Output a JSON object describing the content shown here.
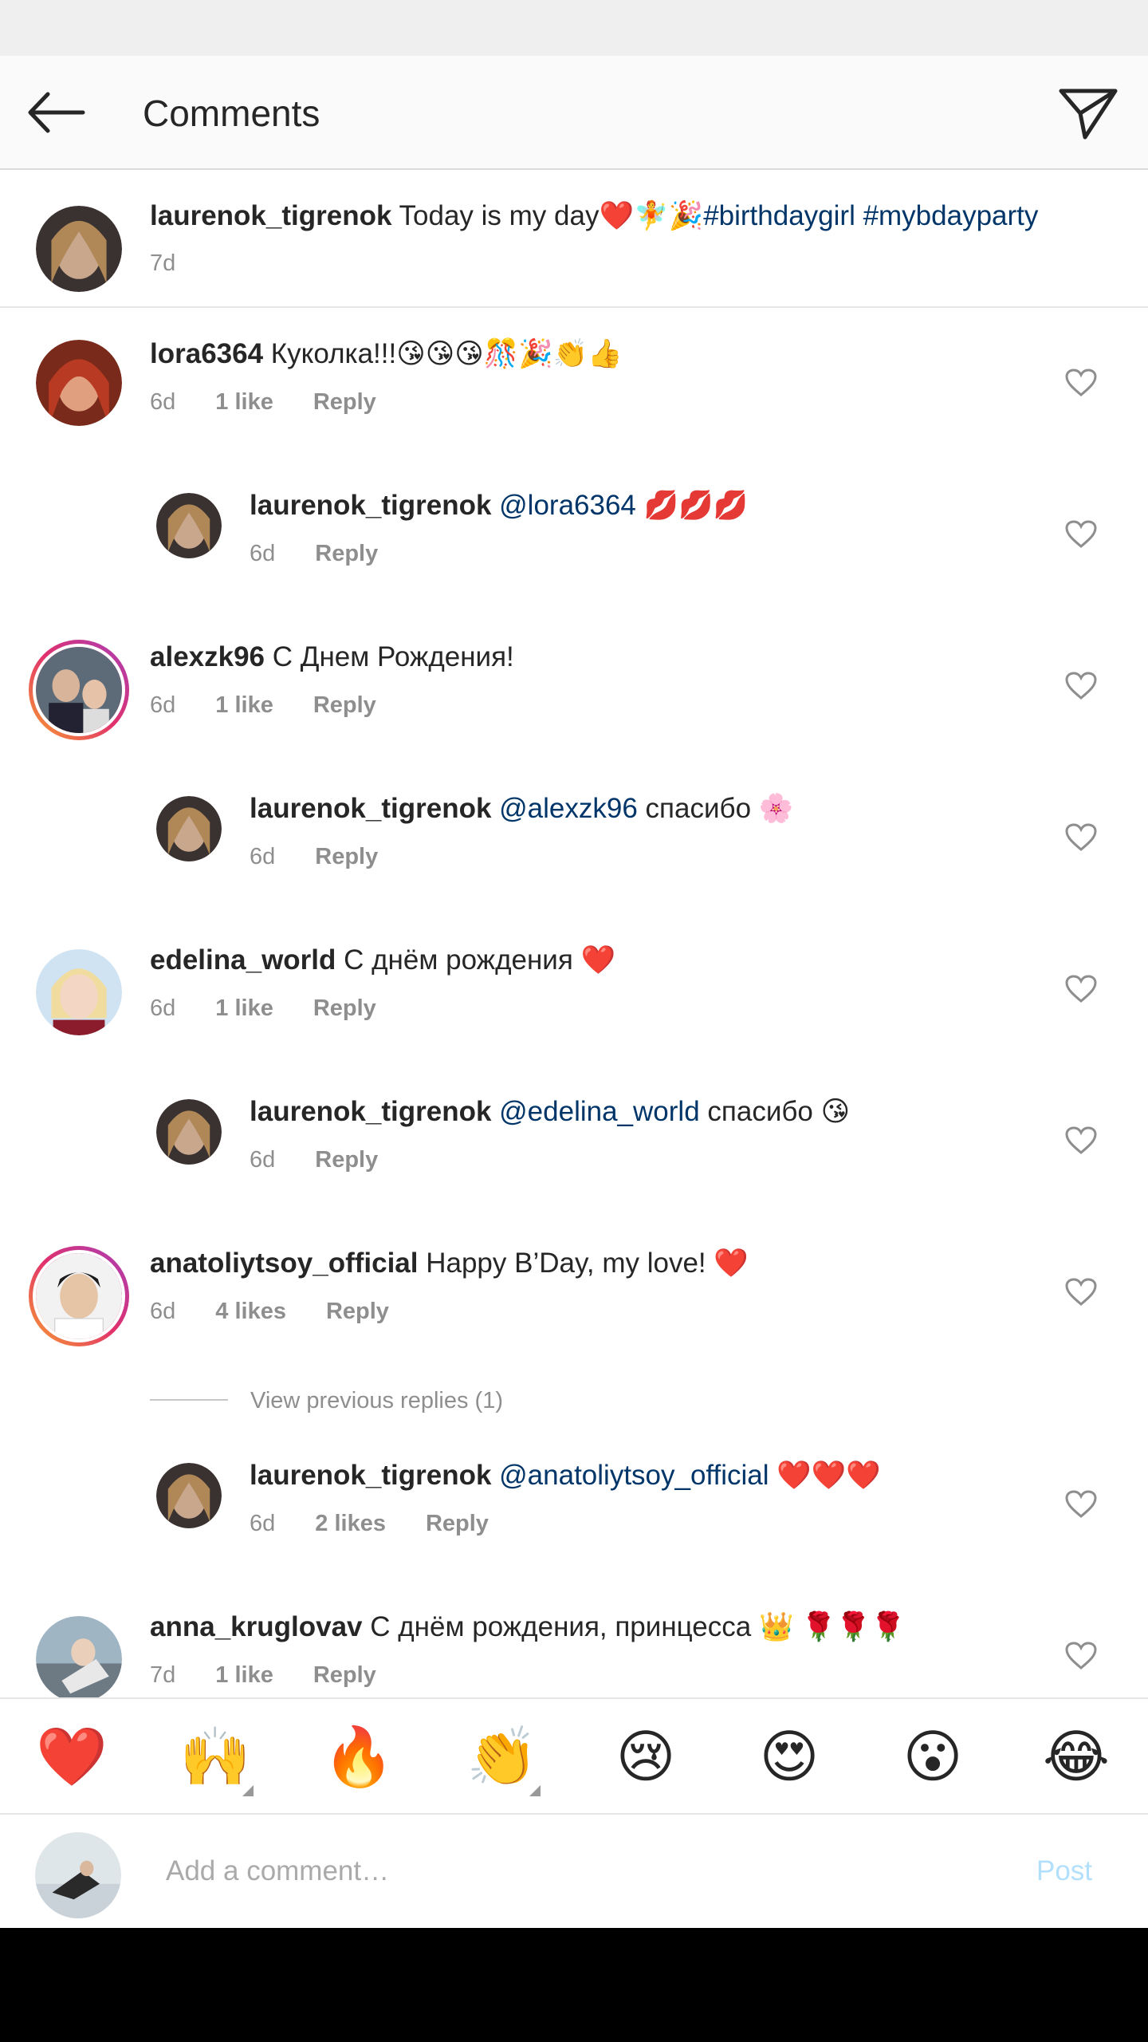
{
  "header": {
    "title": "Comments"
  },
  "caption": {
    "user": "laurenok_tigrenok",
    "text": " Today is my day❤️🧚🎉",
    "hashtags": "#birthdaygirl #mybdayparty",
    "time": "7d"
  },
  "comments": [
    {
      "user": "lora6364",
      "text": " Куколка!!!😘😘😘🎊🎉👏👍",
      "time": "6d",
      "likes": "1 like",
      "reply": "Reply"
    },
    {
      "user": "laurenok_tigrenok",
      "mention": " @lora6364",
      "text": " 💋💋💋",
      "time": "6d",
      "reply": "Reply"
    },
    {
      "user": "alexzk96",
      "text": " С Днем Рождения!",
      "time": "6d",
      "likes": "1 like",
      "reply": "Reply"
    },
    {
      "user": "laurenok_tigrenok",
      "mention": " @alexzk96",
      "text": " спасибо 🌸",
      "time": "6d",
      "reply": "Reply"
    },
    {
      "user": "edelina_world",
      "text": " С днём рождения ❤️",
      "time": "6d",
      "likes": "1 like",
      "reply": "Reply"
    },
    {
      "user": "laurenok_tigrenok",
      "mention": " @edelina_world",
      "text": " спасибо 😘",
      "time": "6d",
      "reply": "Reply"
    },
    {
      "user": "anatoliytsoy_official",
      "text": " Happy B’Day, my love! ❤️",
      "time": "6d",
      "likes": "4 likes",
      "reply": "Reply"
    },
    {
      "user": "laurenok_tigrenok",
      "mention": " @anatoliytsoy_official",
      "text": " ❤️❤️❤️",
      "time": "6d",
      "likes": "2 likes",
      "reply": "Reply"
    },
    {
      "user": "anna_kruglovav",
      "text": " С днём рождения, принцесса 👑 🌹🌹🌹",
      "time": "7d",
      "likes": "1 like",
      "reply": "Reply"
    }
  ],
  "view_previous": "View previous replies (1)",
  "emoji_bar": [
    "❤️",
    "🙌",
    "🔥",
    "👏",
    "😢",
    "😍",
    "😮",
    "😂"
  ],
  "input": {
    "placeholder": "Add a comment…",
    "post_label": "Post"
  },
  "colors": {
    "mention": "#003569",
    "post_disabled": "#b2dffc",
    "meta": "#8e8e8e"
  },
  "icons": {
    "back": "arrow-left-icon",
    "send": "paper-plane-icon",
    "heart": "heart-outline-icon"
  }
}
